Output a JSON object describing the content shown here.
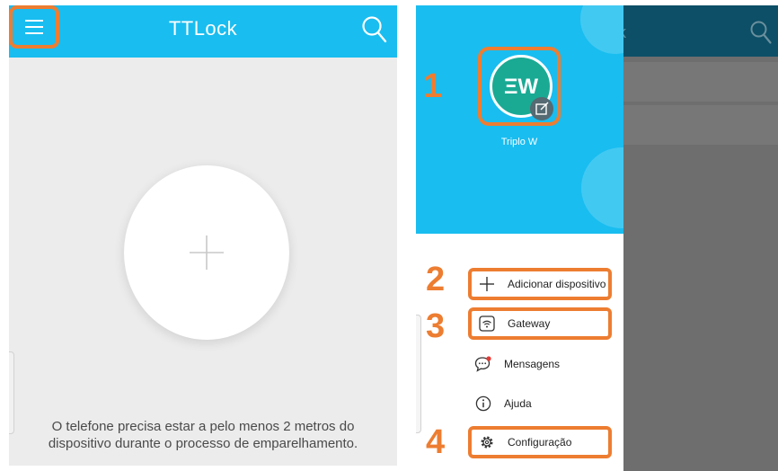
{
  "left_screen": {
    "app_title": "TTLock",
    "menu_icon": "hamburger-menu-icon",
    "search_icon": "search-icon",
    "add_icon": "plus-icon",
    "hint_line1": "O telefone precisa estar a pelo menos 2 metros do",
    "hint_line2": "dispositivo durante o processo de emparelhamento."
  },
  "right_screen": {
    "background_title_fragment": "k",
    "user": {
      "name": "Triplo W",
      "avatar_text": "ΞW",
      "edit_icon": "edit-icon"
    },
    "menu_items": [
      {
        "label": "Adicionar dispositivo",
        "icon": "plus-icon",
        "step": "2"
      },
      {
        "label": "Gateway",
        "icon": "wifi-icon",
        "step": "3"
      },
      {
        "label": "Mensagens",
        "icon": "chat-bubble-icon",
        "step": ""
      },
      {
        "label": "Ajuda",
        "icon": "info-icon",
        "step": ""
      },
      {
        "label": "Configuração",
        "icon": "gear-icon",
        "step": "4"
      }
    ],
    "avatar_step": "1"
  },
  "colors": {
    "app_blue": "#19bdf0",
    "highlight_orange": "#ed7d31",
    "avatar_teal": "#1aaa94"
  }
}
